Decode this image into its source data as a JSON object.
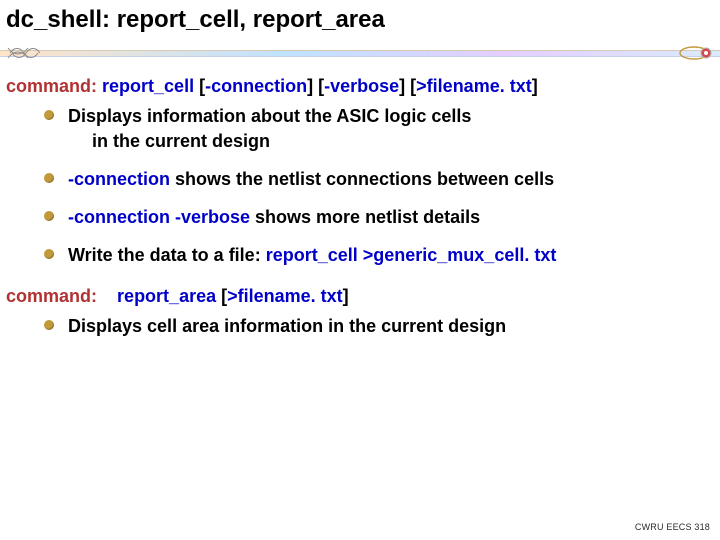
{
  "title": "dc_shell: report_cell, report_area",
  "command1": {
    "label": "command:",
    "name": "report_cell",
    "options": [
      {
        "text": "-connection"
      },
      {
        "text": "-verbose"
      },
      {
        "text": ">filename. txt"
      }
    ]
  },
  "bullets1": [
    {
      "line1": "Displays information about the ASIC logic cells",
      "line2": "in the current design"
    },
    {
      "pre": "-connection",
      "post": " shows the netlist connections between cells"
    },
    {
      "pre": "-connection -verbose",
      "post": " shows more netlist details"
    },
    {
      "plainPre": "Write the data to a file: ",
      "em": "report_cell >generic_mux_cell. txt"
    }
  ],
  "command2": {
    "label": "command:",
    "name": "report_area",
    "options": [
      {
        "text": ">filename. txt"
      }
    ]
  },
  "bullets2": [
    {
      "line1": "Displays cell area information in the current design"
    }
  ],
  "footer": "CWRU EECS 318"
}
